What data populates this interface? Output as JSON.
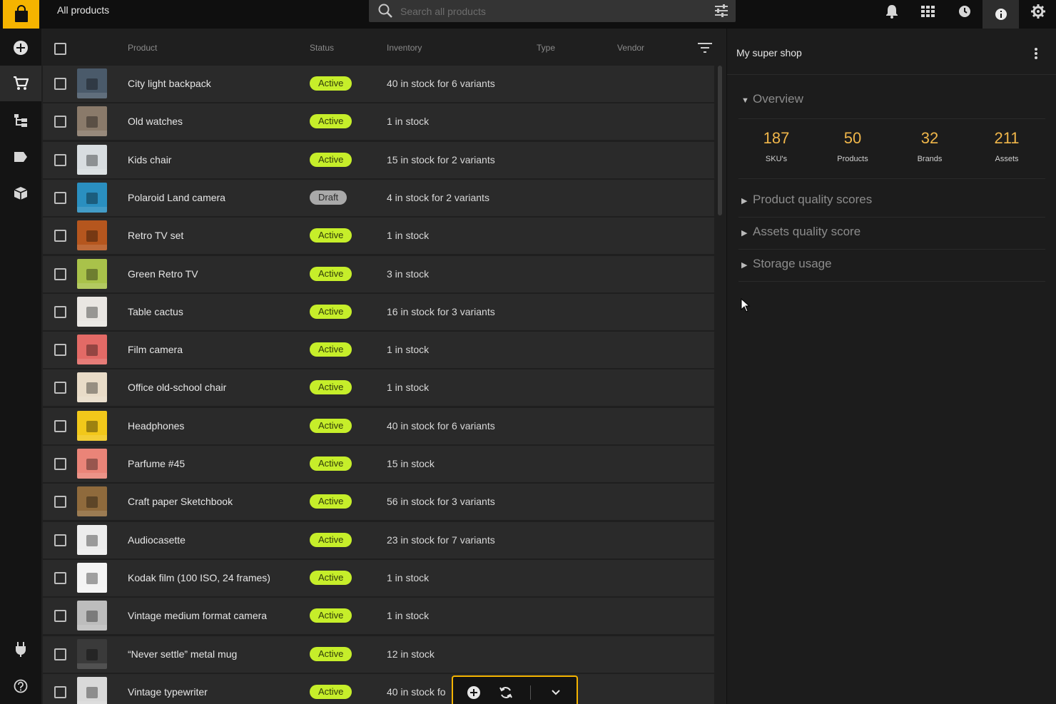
{
  "app": {
    "title": "All products",
    "search_placeholder": "Search all products"
  },
  "icons": {
    "logo": "shopping-bag-icon",
    "top": [
      "bell-icon",
      "grid-icon",
      "clock-icon",
      "info-icon",
      "gear-icon"
    ],
    "nav": [
      "add-circle-icon",
      "cart-icon",
      "tree-icon",
      "tag-icon",
      "box-icon",
      "plug-icon",
      "help-icon"
    ]
  },
  "colors": {
    "accent": "#f5b400",
    "active_badge": "#c6ee2a",
    "draft_badge": "#a9a9a9",
    "stat_number": "#f0b64a"
  },
  "table": {
    "columns": {
      "product": "Product",
      "status": "Status",
      "inventory": "Inventory",
      "type": "Type",
      "vendor": "Vendor"
    },
    "rows": [
      {
        "name": "City light backpack",
        "status": "Active",
        "inventory": "40 in stock for 6 variants",
        "thumb": "#4a5a6a"
      },
      {
        "name": "Old watches",
        "status": "Active",
        "inventory": "1 in stock",
        "thumb": "#8a7a6a"
      },
      {
        "name": "Kids chair",
        "status": "Active",
        "inventory": "15 in stock for 2 variants",
        "thumb": "#d8dde0"
      },
      {
        "name": "Polaroid Land camera",
        "status": "Draft",
        "inventory": "4 in stock for 2 variants",
        "thumb": "#2a8fc0"
      },
      {
        "name": "Retro TV set",
        "status": "Active",
        "inventory": "1 in stock",
        "thumb": "#b5561e"
      },
      {
        "name": "Green Retro TV",
        "status": "Active",
        "inventory": "3 in stock",
        "thumb": "#a9c24a"
      },
      {
        "name": "Table cactus",
        "status": "Active",
        "inventory": "16 in stock for 3 variants",
        "thumb": "#e9e6e2"
      },
      {
        "name": "Film camera",
        "status": "Active",
        "inventory": "1 in stock",
        "thumb": "#e36a66"
      },
      {
        "name": "Office old-school chair",
        "status": "Active",
        "inventory": "1 in stock",
        "thumb": "#e9dcc8"
      },
      {
        "name": "Headphones",
        "status": "Active",
        "inventory": "40 in stock for 6 variants",
        "thumb": "#f2c81a"
      },
      {
        "name": "Parfume #45",
        "status": "Active",
        "inventory": "15 in stock",
        "thumb": "#ea8478"
      },
      {
        "name": "Craft paper Sketchbook",
        "status": "Active",
        "inventory": "56 in stock for 3 variants",
        "thumb": "#8f6a3c"
      },
      {
        "name": "Audiocasette",
        "status": "Active",
        "inventory": "23 in stock for 7 variants",
        "thumb": "#ededed"
      },
      {
        "name": "Kodak film (100 ISO, 24 frames)",
        "status": "Active",
        "inventory": "1 in stock",
        "thumb": "#f4f4f4"
      },
      {
        "name": "Vintage medium format camera",
        "status": "Active",
        "inventory": "1 in stock",
        "thumb": "#bdbdbd"
      },
      {
        "name": "“Never settle” metal mug",
        "status": "Active",
        "inventory": "12 in stock",
        "thumb": "#3a3a3a"
      },
      {
        "name": "Vintage typewriter",
        "status": "Active",
        "inventory": "40 in stock fo",
        "thumb": "#d9d9d9"
      }
    ]
  },
  "panel": {
    "title": "My super shop",
    "sections": {
      "overview": "Overview",
      "product_quality": "Product quality scores",
      "assets_quality": "Assets quality score",
      "storage": "Storage usage"
    },
    "stats": [
      {
        "value": "187",
        "label": "SKU's"
      },
      {
        "value": "50",
        "label": "Products"
      },
      {
        "value": "32",
        "label": "Brands"
      },
      {
        "value": "211",
        "label": "Assets"
      }
    ]
  },
  "toolbar": {
    "icons": [
      "add-circle-icon",
      "refresh-icon",
      "chevron-down-icon"
    ]
  }
}
